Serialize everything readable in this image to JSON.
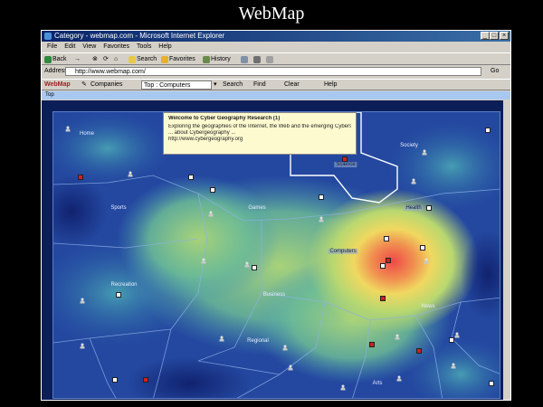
{
  "slide": {
    "title": "WebMap"
  },
  "window": {
    "title": "Category - webmap.com - Microsoft Internet Explorer",
    "controls": {
      "minimize": "_",
      "maximize": "□",
      "close": "×"
    }
  },
  "menu": {
    "items": [
      "File",
      "Edit",
      "View",
      "Favorites",
      "Tools",
      "Help"
    ]
  },
  "toolbar": {
    "back": "Back",
    "forward": "→",
    "stop": "⊗",
    "refresh": "⟳",
    "home": "⌂",
    "search": "Search",
    "favorites": "Favorites",
    "history": "History"
  },
  "address": {
    "label": "Address",
    "value": "http://www.webmap.com/",
    "go": "Go"
  },
  "links": {
    "brand": "WebMap",
    "label": "Companies",
    "category": "Top : Computers",
    "search_btn": "Search",
    "find_btn": "Find",
    "clear_btn": "Clear",
    "help_btn": "Help"
  },
  "nav": {
    "crumb": "Top"
  },
  "tooltip": {
    "title": "Welcome to Cyber Geography Research (1)",
    "line1": "Exploring the geographies of the Internet, the Web and the emerging Cyberspace",
    "line2": "... about Cybergeography ...",
    "line3": "http://www.cybergeography.org"
  },
  "regions": {
    "home": "Home",
    "society": "Society",
    "sports": "Sports",
    "games": "Games",
    "computers": "Computers",
    "recreation": "Recreation",
    "business": "Business",
    "news": "News",
    "regional": "Regional",
    "arts": "Arts",
    "science": "Science",
    "health": "Health"
  }
}
